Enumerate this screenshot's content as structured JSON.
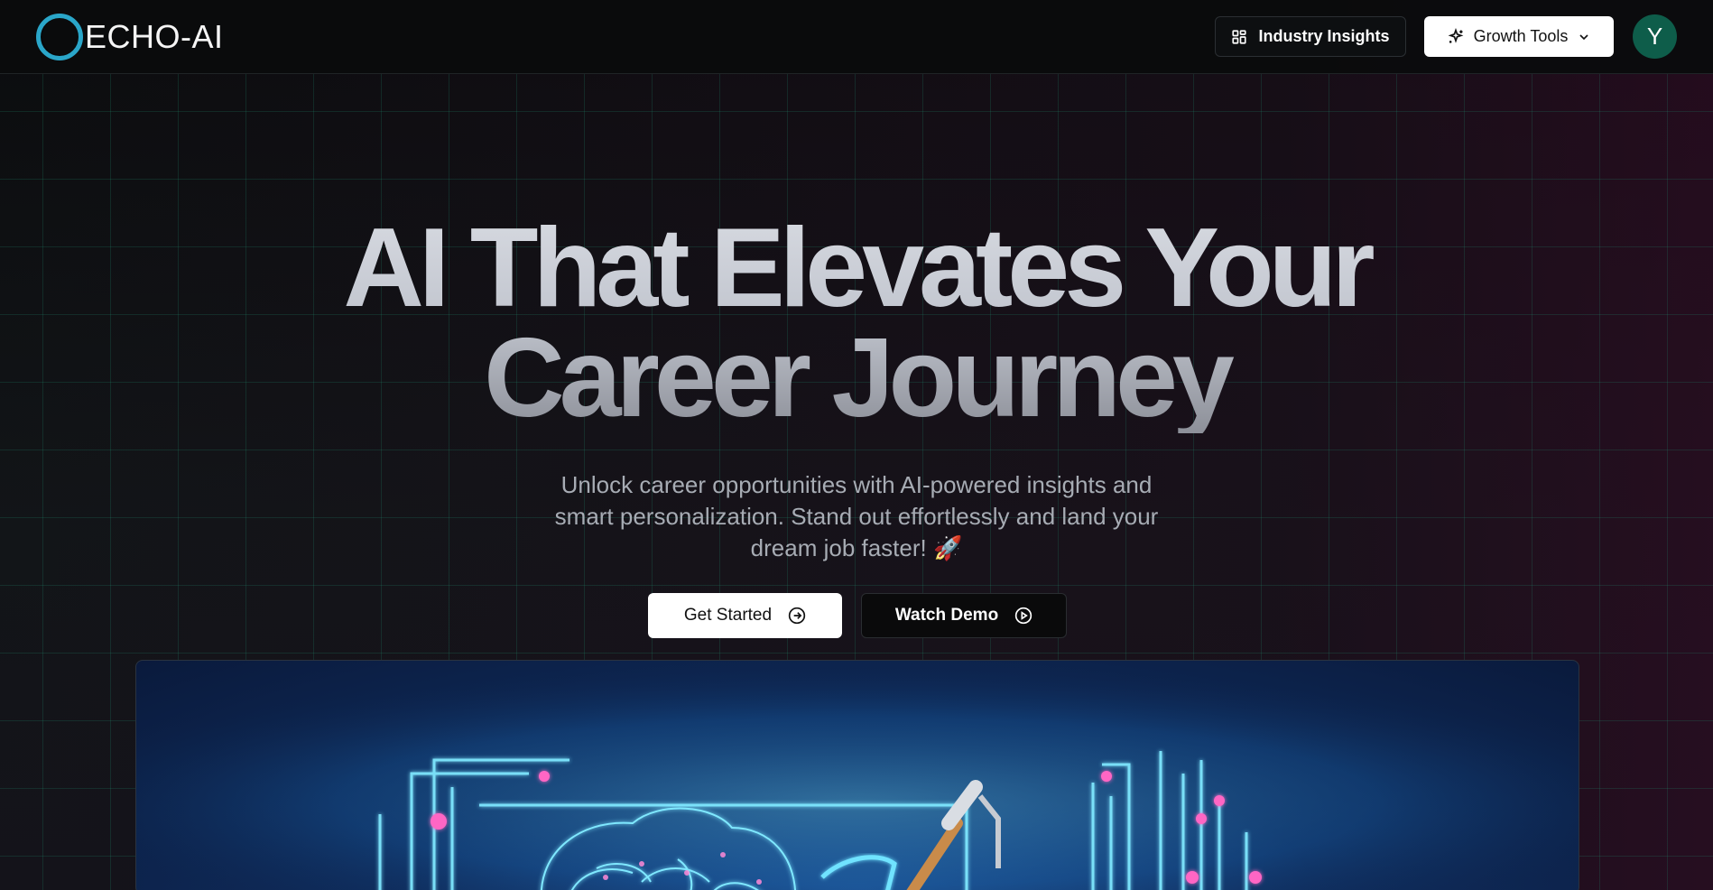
{
  "brand": {
    "name": "ECHO-AI"
  },
  "nav": {
    "industry_insights": "Industry Insights",
    "growth_tools": "Growth Tools",
    "avatar_initial": "Y"
  },
  "hero": {
    "title_line1": "AI That Elevates Your",
    "title_line2": "Career Journey",
    "subtitle_line1": "Unlock career opportunities with AI-powered insights and",
    "subtitle_line2": "smart personalization. Stand out effortlessly and land your",
    "subtitle_line3": "dream job faster! 🚀",
    "get_started": "Get Started",
    "watch_demo": "Watch Demo"
  },
  "icons": {
    "insights": "layout-grid-icon",
    "growth": "sparkles-icon",
    "dropdown": "chevron-down-icon",
    "get_started": "arrow-right-circle-icon",
    "watch_demo": "play-circle-icon"
  },
  "colors": {
    "logo_ring": "#2aa6c9",
    "avatar_bg": "#0e5d4a",
    "grid_lines": "#1e8c6e"
  }
}
